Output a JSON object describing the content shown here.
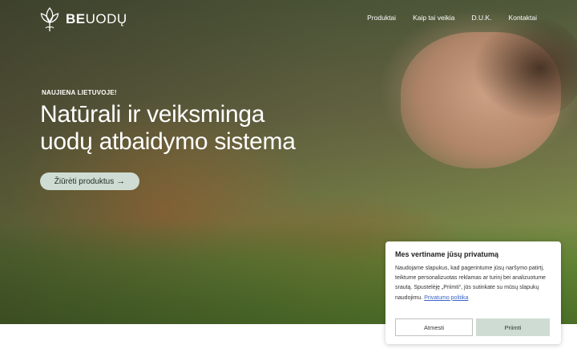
{
  "header": {
    "logo_bold": "BE",
    "logo_light": "UODŲ",
    "logo_icon": "leaf-lotus-icon",
    "nav": [
      {
        "label": "Produktai"
      },
      {
        "label": "Kaip tai veikia"
      },
      {
        "label": "D.U.K."
      },
      {
        "label": "Kontaktai"
      }
    ]
  },
  "hero": {
    "kicker": "NAUJIENA LIETUVOJE!",
    "headline_line1": "Natūrali ir veiksminga",
    "headline_line2": "uodų atbaidymo sistema",
    "cta_label": "Žiūrėti produktus",
    "cta_icon": "arrow-right-icon"
  },
  "cookie": {
    "title": "Mes vertiname jūsų privatumą",
    "body": "Naudojame slapukus, kad pagerintume jūsų naršymo patirtį, teiktume personalizuotas reklamas ar turinį bei analizuotume srautą. Spustelėję „Priimti“, jūs sutinkate su mūsų slapukų naudojimu.",
    "link": "Privatumo politika",
    "decline_label": "Atmesti",
    "accept_label": "Priimti"
  },
  "colors": {
    "accent": "#cfdcd3",
    "link": "#3c64c8",
    "text_dark": "#222222"
  }
}
